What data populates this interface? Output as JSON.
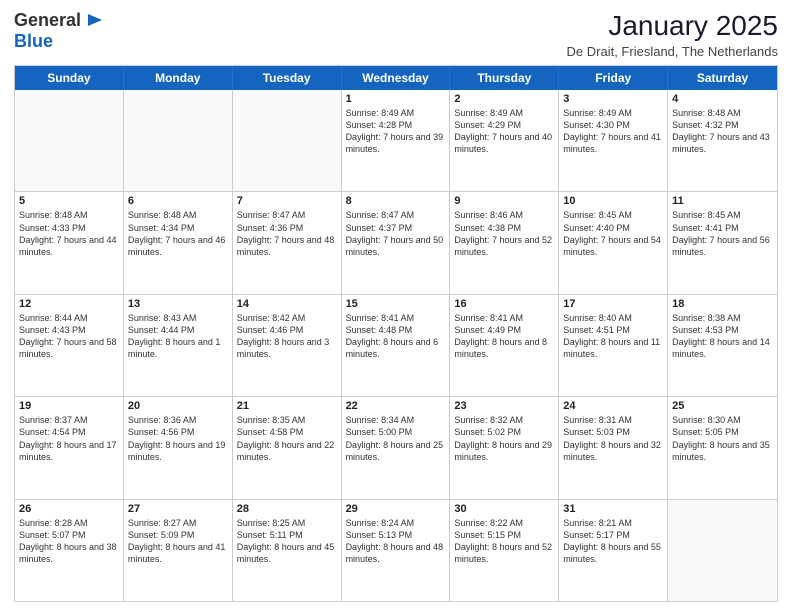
{
  "header": {
    "logo_general": "General",
    "logo_blue": "Blue",
    "month_title": "January 2025",
    "location": "De Drait, Friesland, The Netherlands"
  },
  "days_of_week": [
    "Sunday",
    "Monday",
    "Tuesday",
    "Wednesday",
    "Thursday",
    "Friday",
    "Saturday"
  ],
  "weeks": [
    [
      {
        "day": "",
        "info": ""
      },
      {
        "day": "",
        "info": ""
      },
      {
        "day": "",
        "info": ""
      },
      {
        "day": "1",
        "info": "Sunrise: 8:49 AM\nSunset: 4:28 PM\nDaylight: 7 hours and 39 minutes."
      },
      {
        "day": "2",
        "info": "Sunrise: 8:49 AM\nSunset: 4:29 PM\nDaylight: 7 hours and 40 minutes."
      },
      {
        "day": "3",
        "info": "Sunrise: 8:49 AM\nSunset: 4:30 PM\nDaylight: 7 hours and 41 minutes."
      },
      {
        "day": "4",
        "info": "Sunrise: 8:48 AM\nSunset: 4:32 PM\nDaylight: 7 hours and 43 minutes."
      }
    ],
    [
      {
        "day": "5",
        "info": "Sunrise: 8:48 AM\nSunset: 4:33 PM\nDaylight: 7 hours and 44 minutes."
      },
      {
        "day": "6",
        "info": "Sunrise: 8:48 AM\nSunset: 4:34 PM\nDaylight: 7 hours and 46 minutes."
      },
      {
        "day": "7",
        "info": "Sunrise: 8:47 AM\nSunset: 4:36 PM\nDaylight: 7 hours and 48 minutes."
      },
      {
        "day": "8",
        "info": "Sunrise: 8:47 AM\nSunset: 4:37 PM\nDaylight: 7 hours and 50 minutes."
      },
      {
        "day": "9",
        "info": "Sunrise: 8:46 AM\nSunset: 4:38 PM\nDaylight: 7 hours and 52 minutes."
      },
      {
        "day": "10",
        "info": "Sunrise: 8:45 AM\nSunset: 4:40 PM\nDaylight: 7 hours and 54 minutes."
      },
      {
        "day": "11",
        "info": "Sunrise: 8:45 AM\nSunset: 4:41 PM\nDaylight: 7 hours and 56 minutes."
      }
    ],
    [
      {
        "day": "12",
        "info": "Sunrise: 8:44 AM\nSunset: 4:43 PM\nDaylight: 7 hours and 58 minutes."
      },
      {
        "day": "13",
        "info": "Sunrise: 8:43 AM\nSunset: 4:44 PM\nDaylight: 8 hours and 1 minute."
      },
      {
        "day": "14",
        "info": "Sunrise: 8:42 AM\nSunset: 4:46 PM\nDaylight: 8 hours and 3 minutes."
      },
      {
        "day": "15",
        "info": "Sunrise: 8:41 AM\nSunset: 4:48 PM\nDaylight: 8 hours and 6 minutes."
      },
      {
        "day": "16",
        "info": "Sunrise: 8:41 AM\nSunset: 4:49 PM\nDaylight: 8 hours and 8 minutes."
      },
      {
        "day": "17",
        "info": "Sunrise: 8:40 AM\nSunset: 4:51 PM\nDaylight: 8 hours and 11 minutes."
      },
      {
        "day": "18",
        "info": "Sunrise: 8:38 AM\nSunset: 4:53 PM\nDaylight: 8 hours and 14 minutes."
      }
    ],
    [
      {
        "day": "19",
        "info": "Sunrise: 8:37 AM\nSunset: 4:54 PM\nDaylight: 8 hours and 17 minutes."
      },
      {
        "day": "20",
        "info": "Sunrise: 8:36 AM\nSunset: 4:56 PM\nDaylight: 8 hours and 19 minutes."
      },
      {
        "day": "21",
        "info": "Sunrise: 8:35 AM\nSunset: 4:58 PM\nDaylight: 8 hours and 22 minutes."
      },
      {
        "day": "22",
        "info": "Sunrise: 8:34 AM\nSunset: 5:00 PM\nDaylight: 8 hours and 25 minutes."
      },
      {
        "day": "23",
        "info": "Sunrise: 8:32 AM\nSunset: 5:02 PM\nDaylight: 8 hours and 29 minutes."
      },
      {
        "day": "24",
        "info": "Sunrise: 8:31 AM\nSunset: 5:03 PM\nDaylight: 8 hours and 32 minutes."
      },
      {
        "day": "25",
        "info": "Sunrise: 8:30 AM\nSunset: 5:05 PM\nDaylight: 8 hours and 35 minutes."
      }
    ],
    [
      {
        "day": "26",
        "info": "Sunrise: 8:28 AM\nSunset: 5:07 PM\nDaylight: 8 hours and 38 minutes."
      },
      {
        "day": "27",
        "info": "Sunrise: 8:27 AM\nSunset: 5:09 PM\nDaylight: 8 hours and 41 minutes."
      },
      {
        "day": "28",
        "info": "Sunrise: 8:25 AM\nSunset: 5:11 PM\nDaylight: 8 hours and 45 minutes."
      },
      {
        "day": "29",
        "info": "Sunrise: 8:24 AM\nSunset: 5:13 PM\nDaylight: 8 hours and 48 minutes."
      },
      {
        "day": "30",
        "info": "Sunrise: 8:22 AM\nSunset: 5:15 PM\nDaylight: 8 hours and 52 minutes."
      },
      {
        "day": "31",
        "info": "Sunrise: 8:21 AM\nSunset: 5:17 PM\nDaylight: 8 hours and 55 minutes."
      },
      {
        "day": "",
        "info": ""
      }
    ]
  ]
}
